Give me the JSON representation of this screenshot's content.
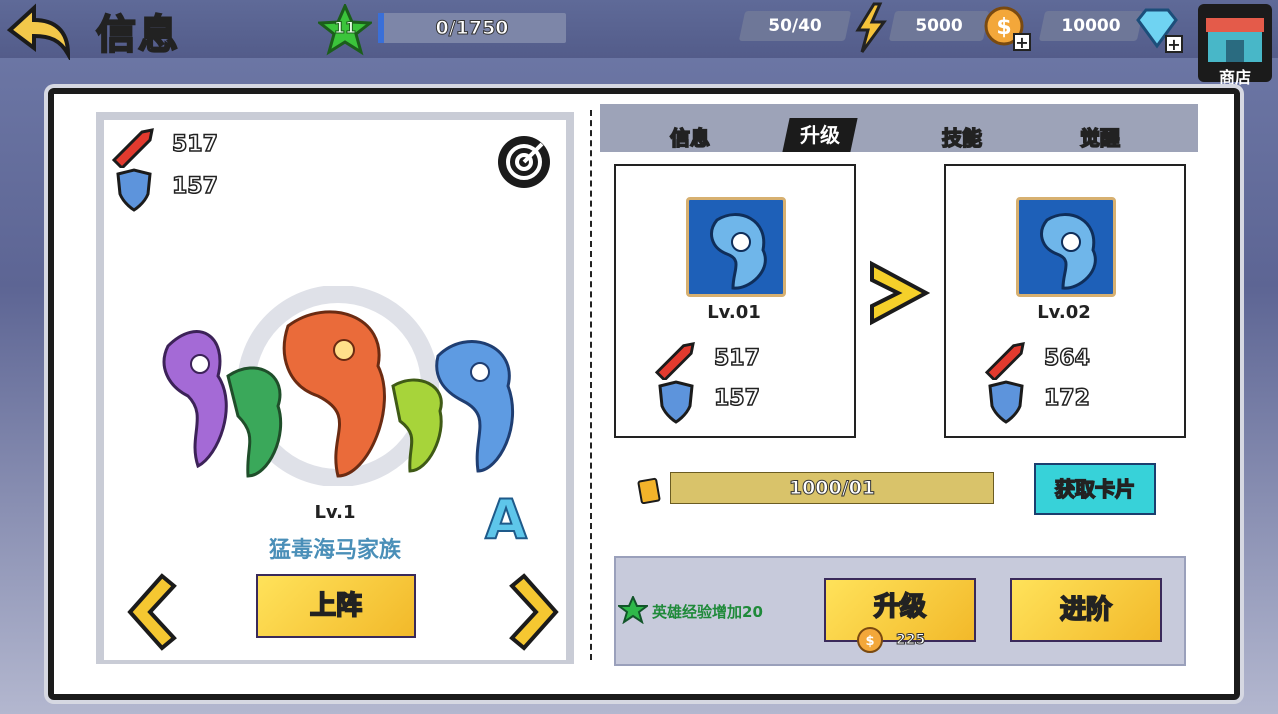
{
  "header": {
    "title": "信息",
    "level": "11",
    "exp_text": "0/1750",
    "exp_progress": 0.03,
    "energy": "50/40",
    "gold": "5000",
    "diamonds": "10000",
    "shop_label": "商店"
  },
  "hero": {
    "attack": "517",
    "defense": "157",
    "level": "Lv.1",
    "name": "猛毒海马家族",
    "rank": "A",
    "deploy_label": "上阵"
  },
  "tabs": [
    {
      "label": "信息"
    },
    {
      "label": "升级"
    },
    {
      "label": "技能"
    },
    {
      "label": "觉醒"
    }
  ],
  "upgrade": {
    "current": {
      "level": "Lv.01",
      "attack": "517",
      "defense": "157"
    },
    "next": {
      "level": "Lv.02",
      "attack": "564",
      "defense": "172"
    },
    "cards_text": "1000/01",
    "get_cards_label": "获取卡片",
    "bonus_text": "英雄经验增加20",
    "upgrade_label": "升级",
    "upgrade_cost": "225",
    "advance_label": "进阶"
  },
  "colors": {
    "accent_yellow": "#f5c731",
    "tab_active": "#1b1b1b",
    "get_cards_cyan": "#37d2d9"
  }
}
